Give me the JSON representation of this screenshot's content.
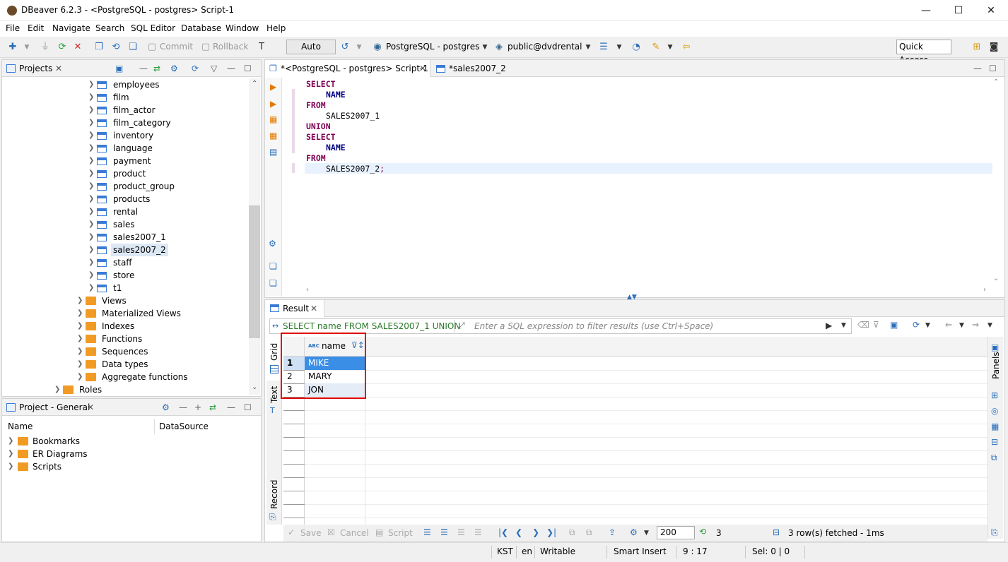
{
  "window": {
    "title": "DBeaver 6.2.3 - <PostgreSQL - postgres> Script-1",
    "minimize": "—",
    "maximize": "☐",
    "close": "✕"
  },
  "menu": [
    "File",
    "Edit",
    "Navigate",
    "Search",
    "SQL Editor",
    "Database",
    "Window",
    "Help"
  ],
  "toolbar": {
    "commit": "Commit",
    "rollback": "Rollback",
    "auto": "Auto",
    "connection": "PostgreSQL - postgres",
    "schema": "public@dvdrental",
    "quick_access": "Quick Access"
  },
  "projects_panel": {
    "tab": "Projects",
    "tables": [
      "employees",
      "film",
      "film_actor",
      "film_category",
      "inventory",
      "language",
      "payment",
      "product",
      "product_group",
      "products",
      "rental",
      "sales",
      "sales2007_1",
      "sales2007_2",
      "staff",
      "store",
      "t1"
    ],
    "selected_table": "sales2007_2",
    "folders": [
      "Views",
      "Materialized Views",
      "Indexes",
      "Functions",
      "Sequences",
      "Data types",
      "Aggregate functions"
    ],
    "roles": "Roles"
  },
  "project_general": {
    "tab": "Project - General",
    "col_name": "Name",
    "col_datasource": "DataSource",
    "items": [
      "Bookmarks",
      "ER Diagrams",
      "Scripts"
    ]
  },
  "editor": {
    "tabs": [
      "*<PostgreSQL - postgres> Script-1",
      "*sales2007_2"
    ],
    "code": [
      {
        "text": "SELECT",
        "type": "kw",
        "indent": 0
      },
      {
        "text": "NAME",
        "type": "kw2",
        "indent": 1
      },
      {
        "text": "FROM",
        "type": "kw",
        "indent": 0
      },
      {
        "text": "SALES2007_1",
        "type": "ident",
        "indent": 1
      },
      {
        "text": "UNION",
        "type": "kw",
        "indent": 0
      },
      {
        "text": "SELECT",
        "type": "kw",
        "indent": 0
      },
      {
        "text": "NAME",
        "type": "kw2",
        "indent": 1
      },
      {
        "text": "FROM",
        "type": "kw",
        "indent": 0
      },
      {
        "text": "SALES2007_2",
        "type": "ident",
        "indent": 1,
        "suffix": ";"
      }
    ]
  },
  "result": {
    "tab": "Result",
    "query": "SELECT name FROM SALES2007_1 UNION",
    "filter_placeholder": "Enter a SQL expression to filter results (use Ctrl+Space)",
    "column": "name",
    "rows": [
      "MIKE",
      "MARY",
      "JON"
    ],
    "row_numbers": [
      "1",
      "2",
      "3"
    ],
    "side_tabs": [
      "Grid",
      "Text",
      "Record"
    ],
    "panels": "Panels",
    "bottom": {
      "save": "Save",
      "cancel": "Cancel",
      "script": "Script",
      "limit": "200",
      "count": "3",
      "fetched": "3 row(s) fetched - 1ms"
    }
  },
  "status": {
    "tz": "KST",
    "lang": "en",
    "mode": "Writable",
    "insert": "Smart Insert",
    "position": "9 : 17",
    "selection": "Sel: 0 | 0"
  },
  "colors": {
    "highlight_box": "#e00000",
    "selected_cell": "#3a8ee6",
    "accent": "#2a6ebb"
  }
}
